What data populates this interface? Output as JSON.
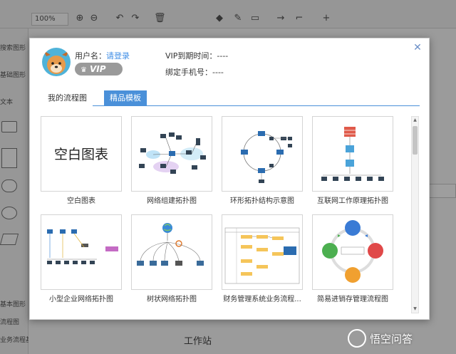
{
  "background": {
    "zoom": "100%",
    "left_labels": [
      "搜索图形",
      "基础图形",
      "文本",
      "基本图形",
      "流程图",
      "业务流程基础图形"
    ],
    "workstation": "工作站"
  },
  "dialog": {
    "user": {
      "name_label": "用户名：",
      "login_link": "请登录",
      "vip_badge": "VIP",
      "vip_expiry_label": "VIP到期时间：----",
      "phone_label": "绑定手机号：----"
    },
    "tabs": [
      {
        "label": "我的流程图",
        "active": false
      },
      {
        "label": "精品模板",
        "active": true
      }
    ],
    "templates": [
      {
        "label": "空白图表",
        "thumb_text": "空白图表"
      },
      {
        "label": "网络组建拓扑图"
      },
      {
        "label": "环形拓扑结构示意图"
      },
      {
        "label": "互联网工作原理拓扑图"
      },
      {
        "label": "小型企业网络拓扑图"
      },
      {
        "label": "树状网络拓扑图"
      },
      {
        "label": "财务管理系统业务流程..."
      },
      {
        "label": "简易进销存管理流程图"
      }
    ],
    "close_icon": "close-icon"
  },
  "watermark": "悟空问答",
  "colors": {
    "accent": "#4a90d9",
    "link": "#3f8ee6",
    "vip_badge": "#9a9a9a"
  }
}
